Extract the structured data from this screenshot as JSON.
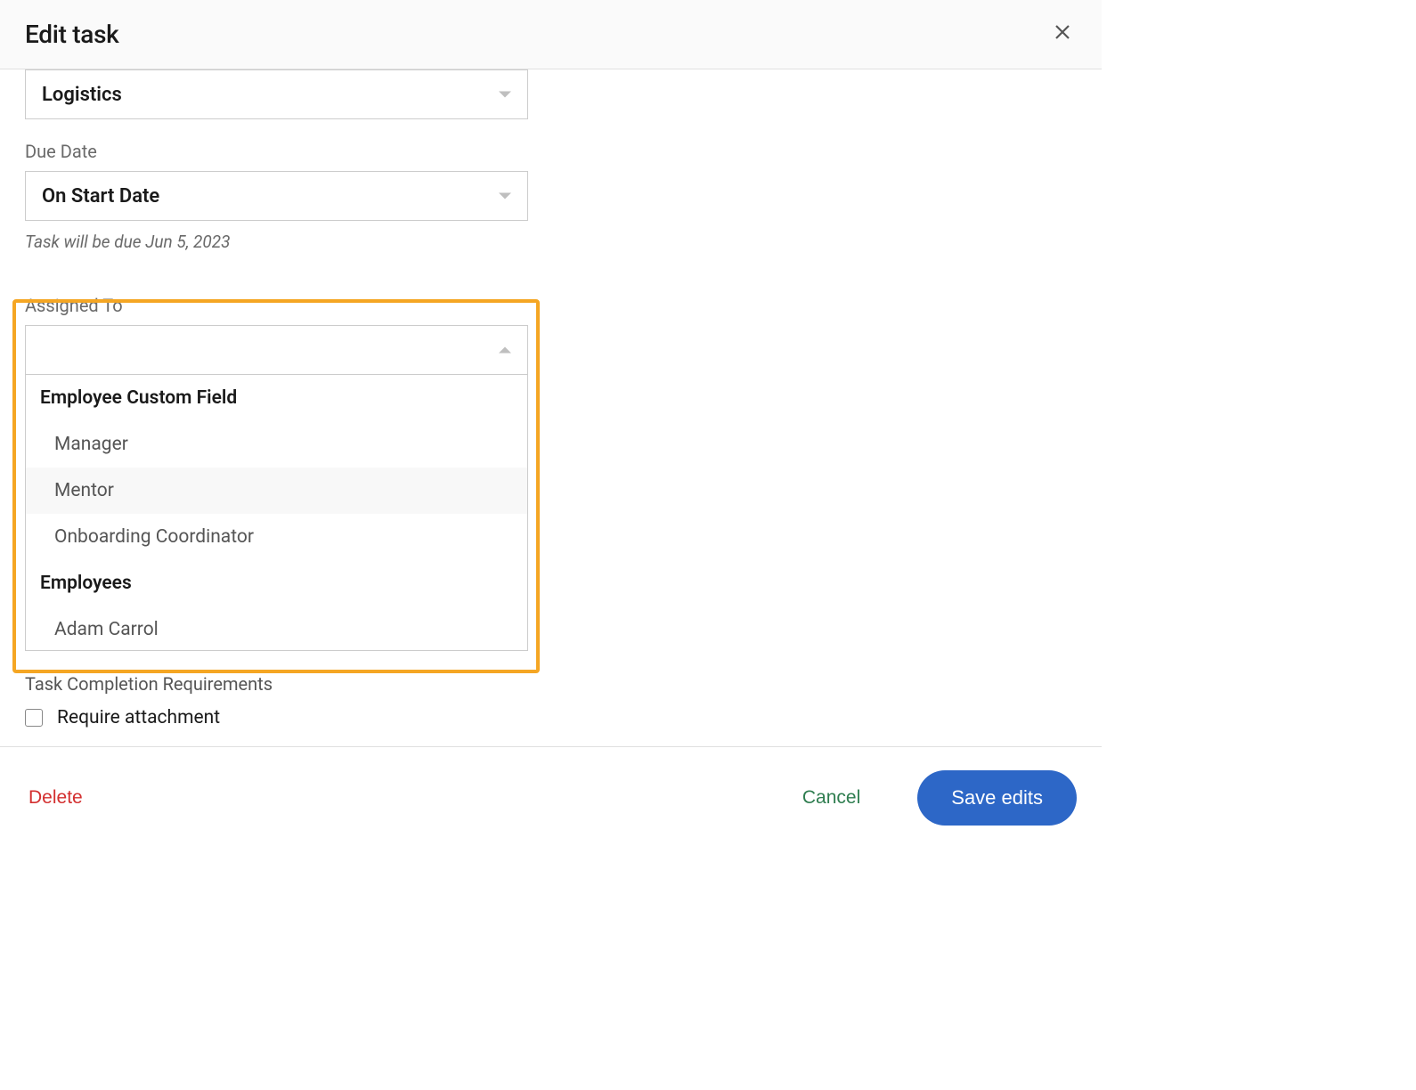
{
  "header": {
    "title": "Edit task"
  },
  "category": {
    "value": "Logistics"
  },
  "due_date": {
    "label": "Due Date",
    "value": "On Start Date",
    "helper": "Task will be due Jun 5, 2023"
  },
  "assigned_to": {
    "label": "Assigned To",
    "value": "",
    "groups": [
      {
        "header": "Employee Custom Field",
        "options": [
          "Manager",
          "Mentor",
          "Onboarding Coordinator"
        ]
      },
      {
        "header": "Employees",
        "options": [
          "Adam Carrol"
        ]
      }
    ]
  },
  "task_requirements": {
    "label": "Task Completion Requirements",
    "require_attachment_label": "Require attachment",
    "require_attachment_checked": false
  },
  "footer": {
    "delete": "Delete",
    "cancel": "Cancel",
    "save": "Save edits"
  }
}
